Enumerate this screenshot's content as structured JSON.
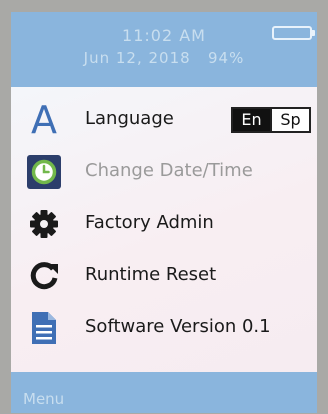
{
  "status": {
    "time": "11:02 AM",
    "date": "Jun 12, 2018",
    "battery_percent": "94%",
    "battery_level": 0.94
  },
  "menu": {
    "items": [
      {
        "label": "Language",
        "icon": "letter-a-icon"
      },
      {
        "label": "Change Date/Time",
        "icon": "clock-icon"
      },
      {
        "label": "Factory Admin",
        "icon": "gear-icon"
      },
      {
        "label": "Runtime Reset",
        "icon": "refresh-icon"
      },
      {
        "label": "Software Version 0.1",
        "icon": "document-icon"
      }
    ],
    "language_options": {
      "active": "En",
      "inactive": "Sp"
    },
    "language_icon_glyph": "A"
  },
  "footer": {
    "label": "Menu"
  },
  "colors": {
    "accent": "#8ab5dd",
    "icon_blue": "#3f6fb5",
    "icon_green": "#72b84b",
    "icon_dark": "#1a1a1a"
  }
}
